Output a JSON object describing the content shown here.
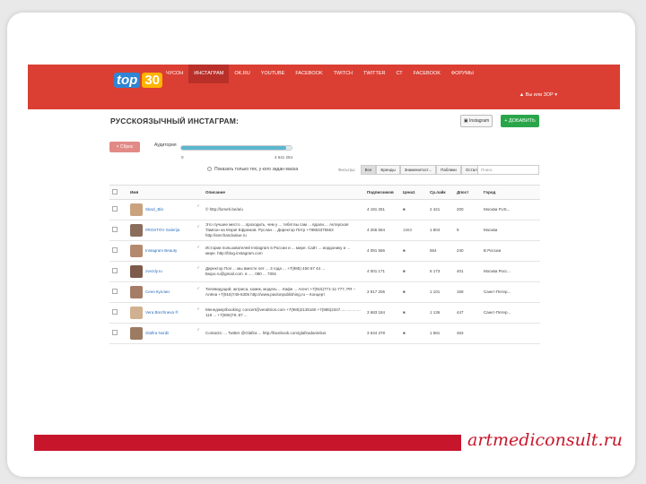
{
  "colors": {
    "topbar": "#db3f33",
    "accent_green": "#2aa54a",
    "brand_red": "#c7162b"
  },
  "logo": {
    "text": "top",
    "number": "30"
  },
  "nav": [
    {
      "label": "ЧУСОН"
    },
    {
      "label": "ИНСТАГРАМ"
    },
    {
      "label": "OK.RU"
    },
    {
      "label": "YOUTUBE"
    },
    {
      "label": "FACEBOOK"
    },
    {
      "label": "TWITCH"
    },
    {
      "label": "TWITTER"
    },
    {
      "label": "СТ"
    },
    {
      "label": "FACEBOOK"
    },
    {
      "label": "ФОРУМЫ"
    }
  ],
  "user": {
    "label": "▲ Вы или 3ОР ▾"
  },
  "page": {
    "title": "РУССКОЯЗЫЧНЫЙ ИНСТАГРАМ:"
  },
  "buttons": {
    "instagram": "Instagram",
    "add": "+ ДОБАВИТЬ",
    "reset": "× Сброс"
  },
  "audience": {
    "label": "Аудитория",
    "min": "0",
    "max": "4 641 254",
    "fill": 0.95
  },
  "checkbox": {
    "label": "Показать только тех, у кого задан маска"
  },
  "filters": {
    "hint": "Фильтры:",
    "items": [
      "Все",
      "Бренды",
      "Знаменитост...",
      "Паблики",
      "Остальное"
    ],
    "search_placeholder": "Поиск"
  },
  "table": {
    "headers": [
      "",
      "Имя",
      "Описание",
      "Подписчиков",
      "Цена1",
      "Ср.лайк",
      "Дпост",
      "Город"
    ],
    "rows": [
      {
        "name": "Skazi_Blo",
        "desc": "© http://lomeh.be/a/u",
        "subs": "4 191 251",
        "c1": "■",
        "likes": "2 421",
        "post": "200",
        "city": "Москва FUS..."
      },
      {
        "name": "#ROSTOV Galerija",
        "desc": "Это лучшее место ....проходить, чем у ... тебя! вы сам ... вдали.... Актерская Тампон на Мэри! Ефремов. Руслан ... Директор Петр +79853376553 http://serchandvalue.ru",
        "subs": "4 266 594",
        "c1": "1683",
        "likes": "1 804",
        "post": "9",
        "city": "Москва"
      },
      {
        "name": "Instagram Beauty",
        "desc": "Истории пользователей Instagram в России и ... мире. Сайт ...  иордонику и ... мире. http://blog.instagram.com",
        "subs": "4 091 566",
        "c1": "■",
        "likes": "564",
        "post": "240",
        "city": "В России"
      },
      {
        "name": "zvezdy.ru",
        "desc": "Директор Поп ... мы вместе лет ... 3 года ... +7(985) 450 67 44 ... Бюро.ru@gmail.com. в ..... 080 ... 7091",
        "subs": "4 001 171",
        "c1": "■",
        "likes": "5 173",
        "post": "401",
        "city": "Москва Росс..."
      },
      {
        "name": "Сеня Куплин",
        "desc": "Телеведущий, актриса, комик, модель ... Кафе ... Агент +7(915)771-11-777, PR – Алёна +7(916)749-5305 http://www.pavlonpublishing.ru – Концерт",
        "subs": "3 917 206",
        "c1": "■",
        "likes": "1 101",
        "post": "159",
        "city": "Санкт-Петер..."
      },
      {
        "name": "Vera Brezhneva ®",
        "desc": "Менеджер/booking: concert@veraltrion.com +7(985)2135160 +7(985)2347...... ... ... ... 119 ... +7(906)79..97 ...",
        "subs": "3 683 184",
        "c1": "■",
        "likes": "1 136",
        "post": "447",
        "city": "Санкт-Петер..."
      },
      {
        "name": "Glafira Nordii",
        "desc": "Contacts: ... Twitter @Glafira ... http://facebook.com/glafiradanielius",
        "subs": "3 634 378",
        "c1": "■",
        "likes": "1 681",
        "post": "463",
        "city": ""
      }
    ]
  },
  "footer": {
    "brand": "artmediconsult.ru"
  }
}
